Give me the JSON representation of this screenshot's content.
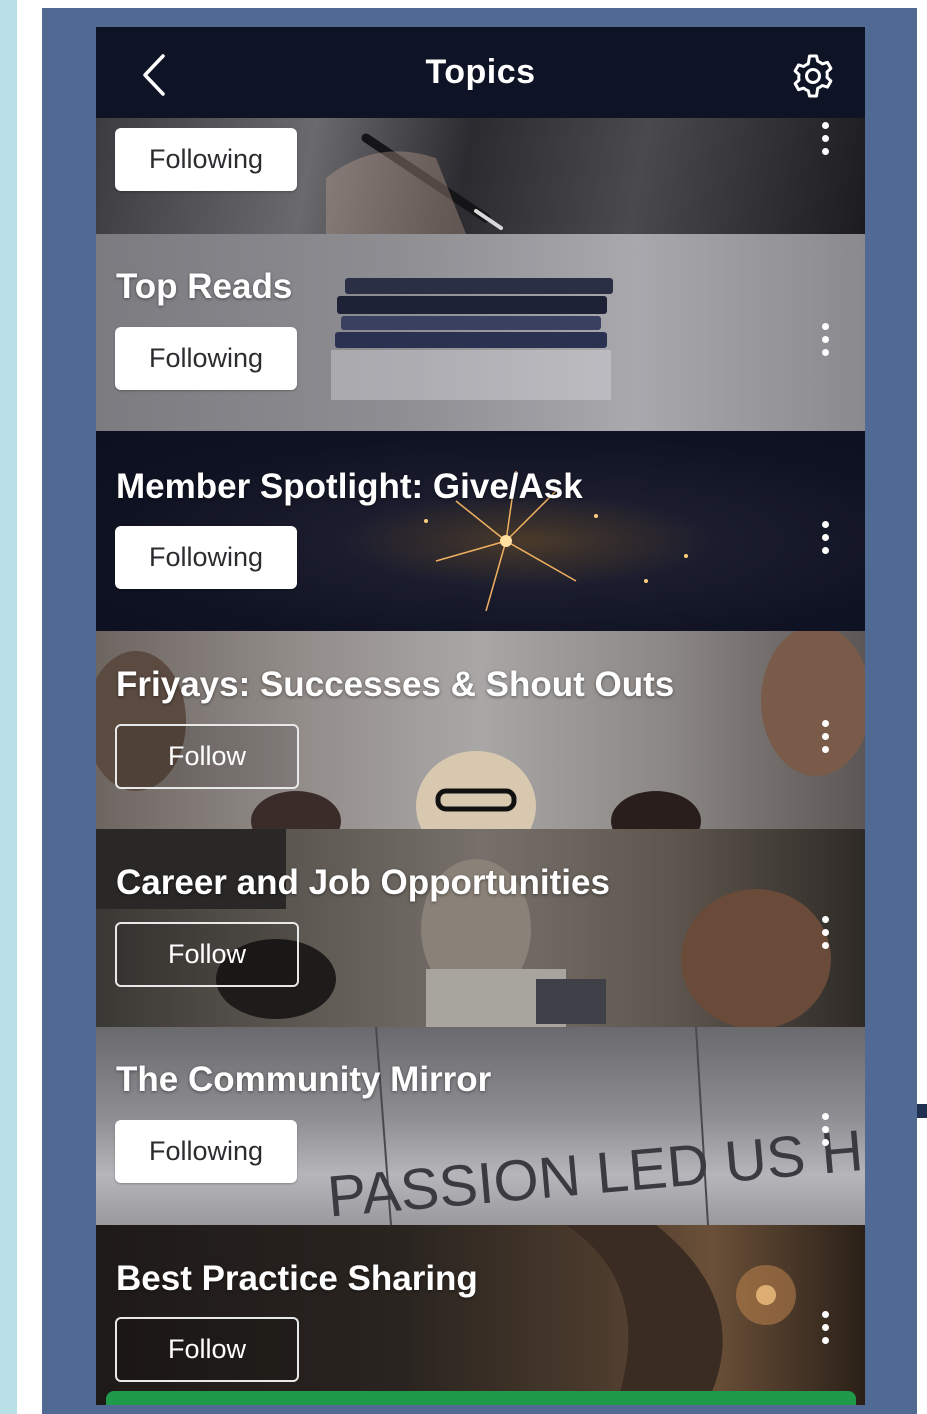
{
  "header": {
    "title": "Topics",
    "back_icon": "chevron-left-icon",
    "settings_icon": "gear-icon"
  },
  "topics": [
    {
      "name": "",
      "button": "Following",
      "following": true
    },
    {
      "name": "Top Reads",
      "button": "Following",
      "following": true
    },
    {
      "name": "Member Spotlight: Give/Ask",
      "button": "Following",
      "following": true
    },
    {
      "name": "Friyays: Successes & Shout Outs",
      "button": "Follow",
      "following": false
    },
    {
      "name": "Career and Job Opportunities",
      "button": "Follow",
      "following": false
    },
    {
      "name": "The Community Mirror",
      "button": "Following",
      "following": true
    },
    {
      "name": "Best Practice Sharing",
      "button": "Follow",
      "following": false
    }
  ],
  "background_text": {
    "mirror_sign": "PASSION LED US HERE"
  },
  "colors": {
    "navbar": "#0e1326",
    "frame": "#506a94",
    "side_strip": "#b9e0e6",
    "bottom_accent": "#1f9a4a"
  }
}
